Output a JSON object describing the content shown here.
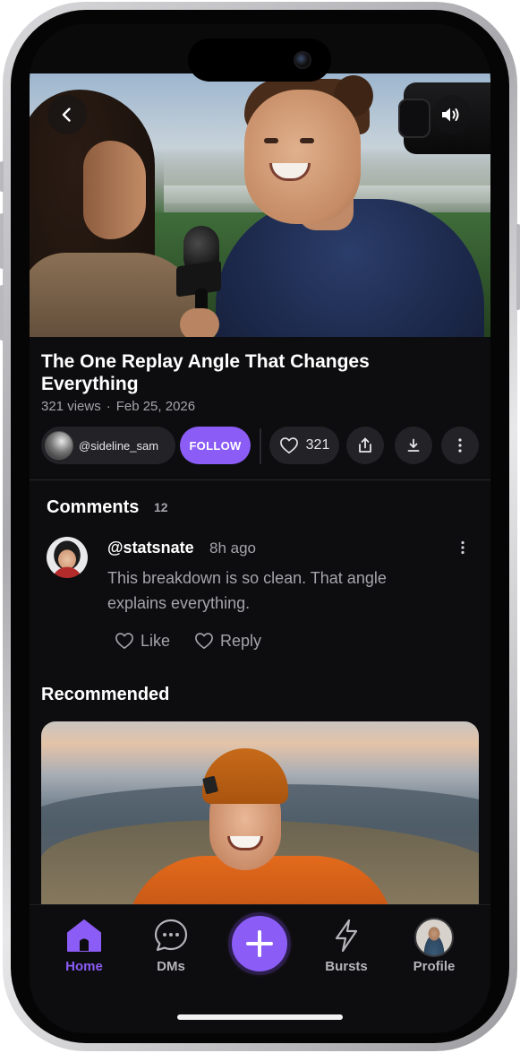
{
  "video": {
    "back_icon": "chevron-left-icon",
    "sound_icon": "speaker-volume-icon"
  },
  "post": {
    "title": "The One Replay Angle That Changes Everything",
    "views": "321 views",
    "separator": "·",
    "date": "Feb 25, 2026"
  },
  "creator": {
    "username": "@sideline_sam",
    "follow_label": "FOLLOW"
  },
  "actions": {
    "likes": "321",
    "like_icon": "heart-icon",
    "share_icon": "share-icon",
    "download_icon": "download-icon",
    "more_icon": "more-vertical-icon"
  },
  "comments": {
    "title": "Comments",
    "count": "12",
    "items": [
      {
        "username": "@statsnate",
        "time": "8h ago",
        "text": "This breakdown is so clean. That angle explains everything.",
        "like_label": "Like",
        "reply_label": "Reply"
      }
    ]
  },
  "recommended": {
    "title": "Recommended"
  },
  "tabbar": {
    "home": "Home",
    "dms": "DMs",
    "bursts": "Bursts",
    "profile": "Profile"
  },
  "colors": {
    "accent": "#8b5cf6",
    "background": "#0d0d0f",
    "chip": "#232327",
    "muted_text": "#a4a4aa"
  }
}
